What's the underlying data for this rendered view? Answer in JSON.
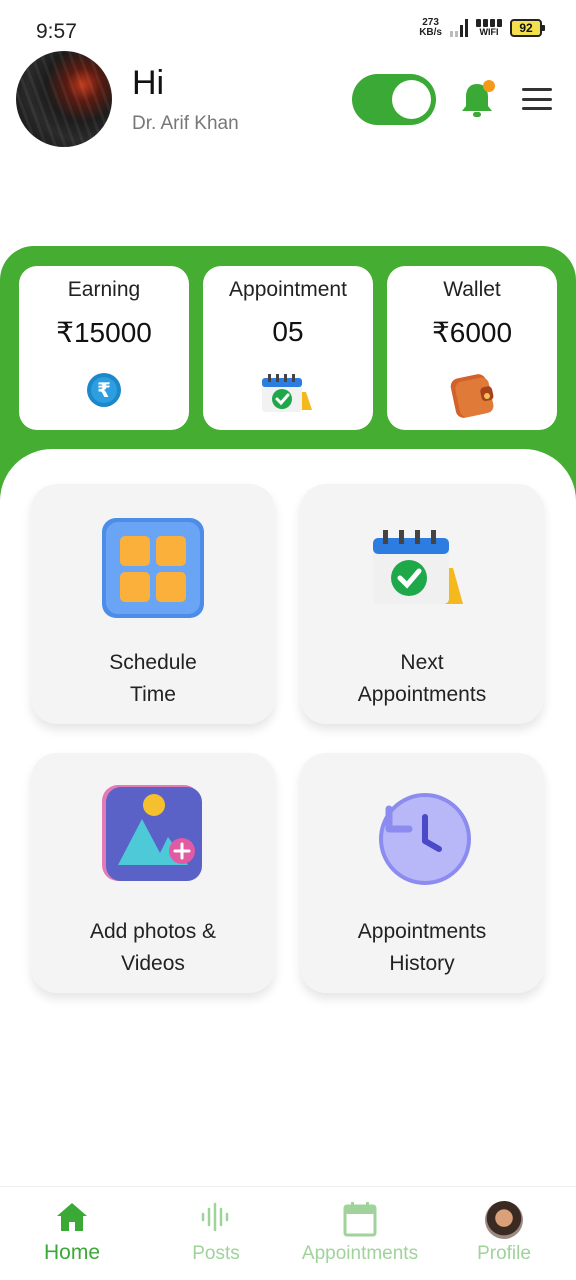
{
  "status_bar": {
    "time": "9:57",
    "net_speed_value": "273",
    "net_speed_unit": "KB/s",
    "wifi_label": "WIFI",
    "battery": "92"
  },
  "header": {
    "greeting": "Hi",
    "doctor_name": "Dr. Arif Khan",
    "availability_toggle_on": true
  },
  "stats": [
    {
      "label": "Earning",
      "value": "₹15000",
      "icon": "rupee-coin-icon"
    },
    {
      "label": "Appointment",
      "value": "05",
      "icon": "calendar-check-icon"
    },
    {
      "label": "Wallet",
      "value": "₹6000",
      "icon": "wallet-icon"
    }
  ],
  "tiles": [
    {
      "line1": "Schedule",
      "line2": "Time",
      "icon": "grid-schedule-icon"
    },
    {
      "line1": "Next",
      "line2": "Appointments",
      "icon": "calendar-check-icon"
    },
    {
      "line1": "Add photos &",
      "line2": "Videos",
      "icon": "add-photo-icon"
    },
    {
      "line1": "Appointments",
      "line2": "History",
      "icon": "history-clock-icon"
    }
  ],
  "nav": [
    {
      "label": "Home",
      "icon": "home-icon",
      "active": true
    },
    {
      "label": "Posts",
      "icon": "waveform-icon",
      "active": false
    },
    {
      "label": "Appointments",
      "icon": "calendar-icon",
      "active": false
    },
    {
      "label": "Profile",
      "icon": "profile-avatar-icon",
      "active": false
    }
  ],
  "colors": {
    "primary_green": "#45ae32",
    "nav_inactive": "#9fd39a",
    "notification_dot": "#f39a1a"
  }
}
